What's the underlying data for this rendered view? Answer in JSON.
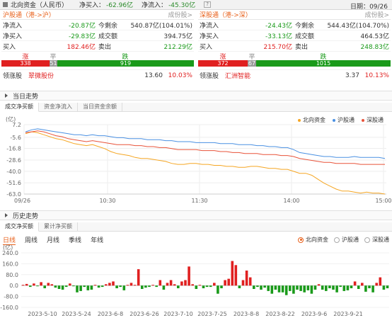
{
  "topbar": {
    "title": "北向资金（人民币）",
    "net_buy_label": "净买入：",
    "net_buy_value": "-62.96亿",
    "net_flow_label": "净流入：",
    "net_flow_value": "-45.30亿",
    "help": "?",
    "date_label": "日期：",
    "date_value": "09/26"
  },
  "sh": {
    "title": "沪股通（港->沪）",
    "link": "成份股>",
    "rows": [
      {
        "k1": "净流入",
        "v1": "-20.87亿",
        "c1": "green",
        "k2": "今剩余",
        "v2": "540.87亿(104.01%)"
      },
      {
        "k1": "净买入",
        "v1": "-29.83亿",
        "c1": "green",
        "k2": "成交额",
        "v2": "394.75亿"
      },
      {
        "k1": "买入",
        "v1": "182.46亿",
        "c1": "red",
        "k2": "卖出",
        "v2": "212.29亿"
      }
    ],
    "up_label": "涨",
    "flat_label": "平",
    "down_label": "跌",
    "up": "338",
    "flat": "51",
    "down": "919",
    "lead_label": "领涨股",
    "lead_name": "翠微股份",
    "lead_price": "13.60",
    "lead_pct": "10.03%"
  },
  "sz": {
    "title": "深股通（港->深）",
    "link": "成份股>",
    "rows": [
      {
        "k1": "净流入",
        "v1": "-24.43亿",
        "c1": "green",
        "k2": "今剩余",
        "v2": "544.43亿(104.70%)"
      },
      {
        "k1": "净买入",
        "v1": "-33.13亿",
        "c1": "green",
        "k2": "成交额",
        "v2": "464.53亿"
      },
      {
        "k1": "买入",
        "v1": "215.70亿",
        "c1": "red",
        "k2": "卖出",
        "v2": "248.83亿"
      }
    ],
    "up_label": "涨",
    "flat_label": "平",
    "down_label": "跌",
    "up": "372",
    "flat": "67",
    "down": "1015",
    "lead_label": "领涨股",
    "lead_name": "汇洲智能",
    "lead_price": "3.37",
    "lead_pct": "10.13%"
  },
  "intraday": {
    "section_title": "当日走势",
    "tabs": [
      "成交净买额",
      "资金净流入",
      "当日资金余额"
    ],
    "legend": [
      {
        "name": "北向资金",
        "color": "#f5a623"
      },
      {
        "name": "沪股通",
        "color": "#4a90e2"
      },
      {
        "name": "深股通",
        "color": "#e8533a"
      }
    ]
  },
  "history": {
    "section_title": "历史走势",
    "tabs": [
      "成交净买额",
      "累计净买额"
    ],
    "periods": [
      "日线",
      "周线",
      "月线",
      "季线",
      "年线"
    ],
    "radios": [
      "北向资金",
      "沪股通",
      "深股通"
    ]
  },
  "chart_data": [
    {
      "type": "line",
      "unit": "(亿)",
      "x_ticks": [
        "09/26",
        "10:30",
        "11:30",
        "14:00",
        "15:00"
      ],
      "y_ticks": [
        7.2,
        -5.6,
        -16.8,
        -28.6,
        -40.0,
        -51.6,
        -63.0
      ],
      "ylim": [
        -63.0,
        7.2
      ],
      "series": [
        {
          "name": "北向资金",
          "color": "#f5a623",
          "values": [
            -2,
            0,
            -1,
            -3,
            -5,
            -7,
            -8,
            -10,
            -12,
            -13,
            -14,
            -13,
            -15,
            -17,
            -20,
            -22,
            -23,
            -24,
            -26,
            -27,
            -27,
            -28,
            -29,
            -30,
            -32,
            -33,
            -33,
            -32,
            -32,
            -33,
            -33,
            -34,
            -34,
            -35,
            -35,
            -36,
            -36,
            -35,
            -35,
            -36,
            -37,
            -37,
            -38,
            -38,
            -40,
            -42,
            -42,
            -44,
            -48,
            -52,
            -55,
            -58,
            -60,
            -60,
            -61,
            -62,
            -61,
            -62,
            -62,
            -63
          ]
        },
        {
          "name": "沪股通",
          "color": "#4a90e2",
          "values": [
            0,
            2,
            3,
            2,
            1,
            0,
            -1,
            -2,
            -3,
            -3,
            -4,
            -3,
            -4,
            -4,
            -5,
            -6,
            -6,
            -7,
            -7,
            -7,
            -8,
            -8,
            -8,
            -9,
            -9,
            -10,
            -10,
            -10,
            -11,
            -11,
            -11,
            -11,
            -12,
            -12,
            -12,
            -13,
            -13,
            -13,
            -14,
            -14,
            -15,
            -15,
            -16,
            -16,
            -18,
            -21,
            -22,
            -23,
            -24,
            -25,
            -25,
            -26,
            -26,
            -26,
            -25,
            -26,
            -26,
            -26,
            -26,
            -27
          ]
        },
        {
          "name": "深股通",
          "color": "#e8533a",
          "values": [
            -1,
            0,
            1,
            0,
            -2,
            -4,
            -5,
            -7,
            -8,
            -9,
            -10,
            -9,
            -10,
            -11,
            -12,
            -13,
            -13,
            -13,
            -14,
            -14,
            -15,
            -15,
            -16,
            -16,
            -17,
            -18,
            -18,
            -18,
            -18,
            -19,
            -19,
            -19,
            -20,
            -20,
            -21,
            -21,
            -22,
            -22,
            -22,
            -23,
            -23,
            -23,
            -24,
            -24,
            -25,
            -27,
            -28,
            -29,
            -30,
            -31,
            -31,
            -32,
            -32,
            -32,
            -32,
            -33,
            -33,
            -33,
            -33,
            -33
          ]
        }
      ]
    },
    {
      "type": "bar",
      "unit": "(亿)",
      "x_ticks": [
        "2023-5-10",
        "2023-5-24",
        "2023-6-8",
        "2023-6-26",
        "2023-7-10",
        "2023-7-25",
        "2023-8-8",
        "2023-8-22",
        "2023-9-6",
        "2023-9-21"
      ],
      "y_ticks": [
        240.0,
        160.0,
        80.0,
        0.0,
        -80.0,
        -160.0
      ],
      "ylim": [
        -160,
        240
      ],
      "values": [
        5,
        12,
        -10,
        15,
        -5,
        25,
        -20,
        20,
        10,
        -15,
        -25,
        -30,
        -10,
        15,
        -5,
        -50,
        -40,
        -10,
        -35,
        -30,
        5,
        -15,
        -10,
        10,
        20,
        30,
        -20,
        -10,
        -35,
        5,
        20,
        5,
        120,
        -25,
        -15,
        -10,
        5,
        -10,
        40,
        -30,
        20,
        40,
        10,
        -20,
        30,
        40,
        140,
        10,
        -25,
        5,
        -20,
        -10,
        -10,
        20,
        -60,
        -20,
        40,
        50,
        180,
        150,
        -20,
        40,
        110,
        60,
        -25,
        -10,
        -30,
        -15,
        -40,
        -60,
        -30,
        -50,
        -50,
        -70,
        -40,
        -60,
        -30,
        -40,
        -50,
        -35,
        -60,
        -30,
        10,
        -30,
        -40,
        -20,
        -30,
        -50,
        -10,
        -40,
        -35,
        -20,
        30,
        -25,
        20,
        -45,
        -20,
        -50,
        20,
        60,
        -30,
        -20
      ]
    }
  ]
}
